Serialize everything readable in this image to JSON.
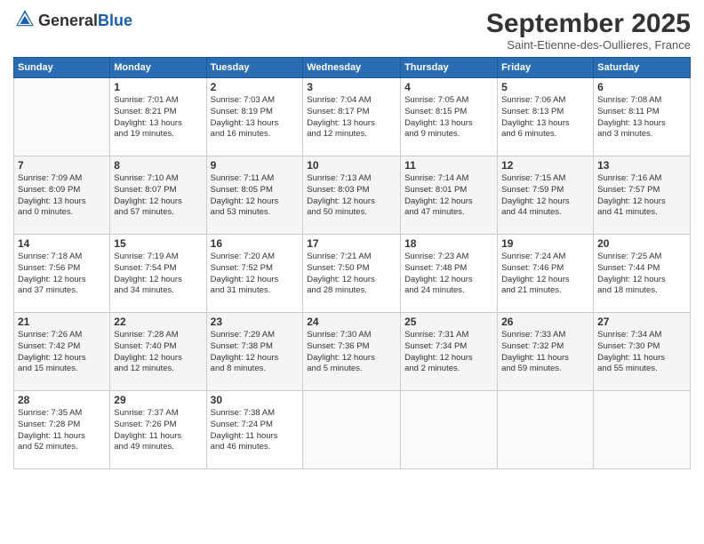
{
  "header": {
    "logo_general": "General",
    "logo_blue": "Blue",
    "month_title": "September 2025",
    "location": "Saint-Etienne-des-Oullieres, France"
  },
  "days_of_week": [
    "Sunday",
    "Monday",
    "Tuesday",
    "Wednesday",
    "Thursday",
    "Friday",
    "Saturday"
  ],
  "weeks": [
    {
      "days": [
        {
          "num": "",
          "info": ""
        },
        {
          "num": "1",
          "info": "Sunrise: 7:01 AM\nSunset: 8:21 PM\nDaylight: 13 hours\nand 19 minutes."
        },
        {
          "num": "2",
          "info": "Sunrise: 7:03 AM\nSunset: 8:19 PM\nDaylight: 13 hours\nand 16 minutes."
        },
        {
          "num": "3",
          "info": "Sunrise: 7:04 AM\nSunset: 8:17 PM\nDaylight: 13 hours\nand 12 minutes."
        },
        {
          "num": "4",
          "info": "Sunrise: 7:05 AM\nSunset: 8:15 PM\nDaylight: 13 hours\nand 9 minutes."
        },
        {
          "num": "5",
          "info": "Sunrise: 7:06 AM\nSunset: 8:13 PM\nDaylight: 13 hours\nand 6 minutes."
        },
        {
          "num": "6",
          "info": "Sunrise: 7:08 AM\nSunset: 8:11 PM\nDaylight: 13 hours\nand 3 minutes."
        }
      ]
    },
    {
      "days": [
        {
          "num": "7",
          "info": "Sunrise: 7:09 AM\nSunset: 8:09 PM\nDaylight: 13 hours\nand 0 minutes."
        },
        {
          "num": "8",
          "info": "Sunrise: 7:10 AM\nSunset: 8:07 PM\nDaylight: 12 hours\nand 57 minutes."
        },
        {
          "num": "9",
          "info": "Sunrise: 7:11 AM\nSunset: 8:05 PM\nDaylight: 12 hours\nand 53 minutes."
        },
        {
          "num": "10",
          "info": "Sunrise: 7:13 AM\nSunset: 8:03 PM\nDaylight: 12 hours\nand 50 minutes."
        },
        {
          "num": "11",
          "info": "Sunrise: 7:14 AM\nSunset: 8:01 PM\nDaylight: 12 hours\nand 47 minutes."
        },
        {
          "num": "12",
          "info": "Sunrise: 7:15 AM\nSunset: 7:59 PM\nDaylight: 12 hours\nand 44 minutes."
        },
        {
          "num": "13",
          "info": "Sunrise: 7:16 AM\nSunset: 7:57 PM\nDaylight: 12 hours\nand 41 minutes."
        }
      ]
    },
    {
      "days": [
        {
          "num": "14",
          "info": "Sunrise: 7:18 AM\nSunset: 7:56 PM\nDaylight: 12 hours\nand 37 minutes."
        },
        {
          "num": "15",
          "info": "Sunrise: 7:19 AM\nSunset: 7:54 PM\nDaylight: 12 hours\nand 34 minutes."
        },
        {
          "num": "16",
          "info": "Sunrise: 7:20 AM\nSunset: 7:52 PM\nDaylight: 12 hours\nand 31 minutes."
        },
        {
          "num": "17",
          "info": "Sunrise: 7:21 AM\nSunset: 7:50 PM\nDaylight: 12 hours\nand 28 minutes."
        },
        {
          "num": "18",
          "info": "Sunrise: 7:23 AM\nSunset: 7:48 PM\nDaylight: 12 hours\nand 24 minutes."
        },
        {
          "num": "19",
          "info": "Sunrise: 7:24 AM\nSunset: 7:46 PM\nDaylight: 12 hours\nand 21 minutes."
        },
        {
          "num": "20",
          "info": "Sunrise: 7:25 AM\nSunset: 7:44 PM\nDaylight: 12 hours\nand 18 minutes."
        }
      ]
    },
    {
      "days": [
        {
          "num": "21",
          "info": "Sunrise: 7:26 AM\nSunset: 7:42 PM\nDaylight: 12 hours\nand 15 minutes."
        },
        {
          "num": "22",
          "info": "Sunrise: 7:28 AM\nSunset: 7:40 PM\nDaylight: 12 hours\nand 12 minutes."
        },
        {
          "num": "23",
          "info": "Sunrise: 7:29 AM\nSunset: 7:38 PM\nDaylight: 12 hours\nand 8 minutes."
        },
        {
          "num": "24",
          "info": "Sunrise: 7:30 AM\nSunset: 7:36 PM\nDaylight: 12 hours\nand 5 minutes."
        },
        {
          "num": "25",
          "info": "Sunrise: 7:31 AM\nSunset: 7:34 PM\nDaylight: 12 hours\nand 2 minutes."
        },
        {
          "num": "26",
          "info": "Sunrise: 7:33 AM\nSunset: 7:32 PM\nDaylight: 11 hours\nand 59 minutes."
        },
        {
          "num": "27",
          "info": "Sunrise: 7:34 AM\nSunset: 7:30 PM\nDaylight: 11 hours\nand 55 minutes."
        }
      ]
    },
    {
      "days": [
        {
          "num": "28",
          "info": "Sunrise: 7:35 AM\nSunset: 7:28 PM\nDaylight: 11 hours\nand 52 minutes."
        },
        {
          "num": "29",
          "info": "Sunrise: 7:37 AM\nSunset: 7:26 PM\nDaylight: 11 hours\nand 49 minutes."
        },
        {
          "num": "30",
          "info": "Sunrise: 7:38 AM\nSunset: 7:24 PM\nDaylight: 11 hours\nand 46 minutes."
        },
        {
          "num": "",
          "info": ""
        },
        {
          "num": "",
          "info": ""
        },
        {
          "num": "",
          "info": ""
        },
        {
          "num": "",
          "info": ""
        }
      ]
    }
  ]
}
